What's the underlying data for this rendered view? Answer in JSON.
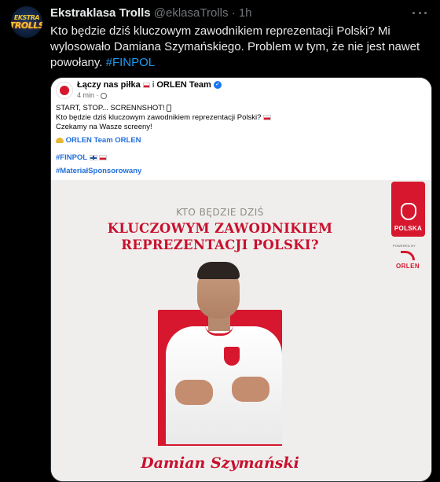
{
  "tweet": {
    "author_name": "Ekstraklasa Trolls",
    "handle": "@eklasaTrolls",
    "separator": "·",
    "time": "1h",
    "avatar_text_top": "EKSTRA",
    "avatar_text_bottom": "TROLLS",
    "text_main": "Kto będzie dziś kluczowym zawodnikiem reprezentacji Polski? Mi wylosowało Damiana Szymańskiego. Problem w tym, że nie jest nawet powołany.",
    "hashtag": "#FINPOL"
  },
  "embedded_post": {
    "title": "Łączy nas piłka",
    "title_icon": "flag-icon",
    "title_sep": "i",
    "partner": "ORLEN Team",
    "time": "4 min",
    "time_sep": "·",
    "line1": "START, STOP... SCRENNSHOT!",
    "line2": "Kto będzie dziś kluczowym zawodnikiem reprezentacji Polski?",
    "line3": "Czekamy na Wasze screeny!",
    "links": [
      "ORLEN Team",
      "ORLEN"
    ],
    "hashtag1": "#FINPOL",
    "hashtag2": "#MateriałSponsorowany"
  },
  "poster": {
    "line1": "KTO BĘDZIE DZIŚ",
    "line2": "KLUCZOWYM ZAWODNIKIEM",
    "line3": "REPREZENTACJI POLSKI?",
    "badge_text": "POLSKA",
    "powered_text": "POWERED BY",
    "sponsor": "ORLEN",
    "player_name": "Damian Szymański"
  },
  "colors": {
    "background": "#000000",
    "text": "#e7e9ea",
    "muted": "#71767b",
    "link": "#1d9bf0",
    "poster_red": "#c8102e"
  }
}
